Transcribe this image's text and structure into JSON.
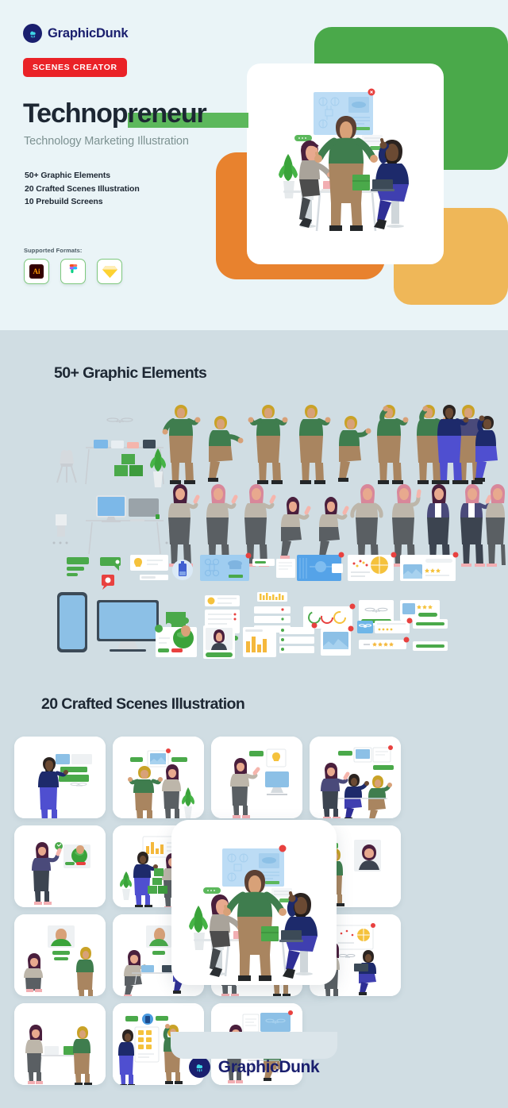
{
  "brand": {
    "name": "GraphicDunk",
    "icon": "cloud-rain-icon",
    "mark_color": "#1a1f6e",
    "accent_color": "#3fd8e8"
  },
  "hero": {
    "badge": "SCENES CREATOR",
    "badge_color": "#ea2227",
    "title": "Technopreneur",
    "title_highlight_color": "#5cb85c",
    "subtitle": "Technology Marketing Illustration",
    "features": [
      "50+ Graphic Elements",
      "20 Crafted Scenes Illustration",
      "10 Prebuild Screens"
    ],
    "formats_label": "Supported Formats:",
    "formats": [
      {
        "name": "adobe-illustrator-icon",
        "label": "Ai"
      },
      {
        "name": "figma-icon",
        "label": "Figma"
      },
      {
        "name": "sketch-icon",
        "label": "Sketch"
      }
    ],
    "decor": {
      "green": "#4aa94a",
      "orange": "#e8822e",
      "amber": "#efb758"
    },
    "background": "#eaf4f7"
  },
  "elements_section": {
    "title": "50+ Graphic Elements",
    "background": "#d0dde3"
  },
  "scenes_section": {
    "title": "20 Crafted Scenes Illustration",
    "background": "#d0dde3",
    "cards": [
      {
        "label": "scene-presenter-board"
      },
      {
        "label": "scene-pair-photo-panel"
      },
      {
        "label": "scene-idea-monitor"
      },
      {
        "label": "scene-team-meeting-board"
      },
      {
        "label": "scene-globe-presenter"
      },
      {
        "label": "scene-charts-boxes"
      },
      {
        "label": "scene-dials-desk"
      },
      {
        "label": "scene-video-call"
      },
      {
        "label": "scene-profile-card"
      },
      {
        "label": "scene-laptop-duo"
      },
      {
        "label": "scene-mobile-app"
      },
      {
        "label": "scene-whiteboard-drone"
      },
      {
        "label": "scene-plant-desk"
      },
      {
        "label": "scene-kanban-board"
      },
      {
        "label": "scene-desk-workstation"
      }
    ]
  },
  "footer": {
    "name": "GraphicDunk",
    "icon": "cloud-rain-icon"
  }
}
